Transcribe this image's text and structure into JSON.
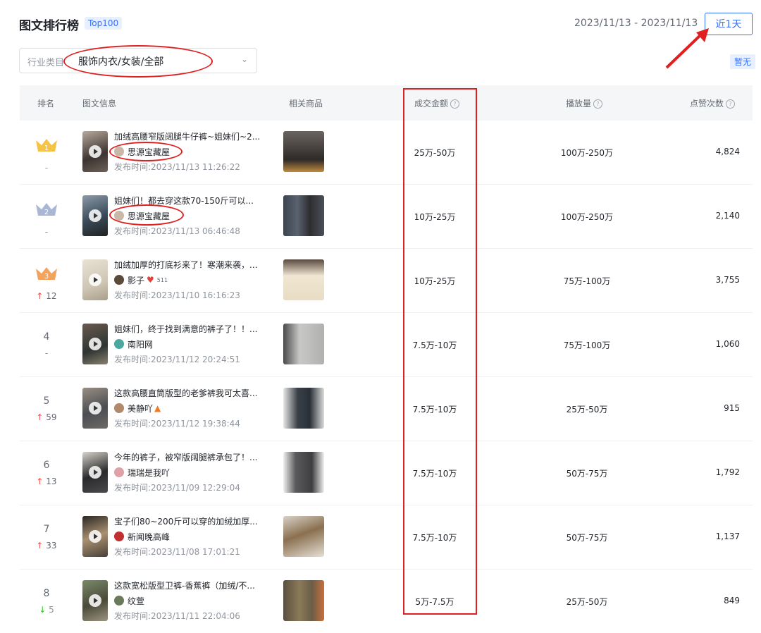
{
  "header": {
    "title": "图文排行榜",
    "badge": "Top100",
    "date_range": "2023/11/13 - 2023/11/13",
    "period_button": "近1天",
    "no_data_tag": "暂无"
  },
  "filter": {
    "label": "行业类目",
    "value": "服饰内衣/女装/全部"
  },
  "columns": {
    "rank": "排名",
    "info": "图文信息",
    "products": "相关商品",
    "gmv": "成交金额",
    "plays": "播放量",
    "likes": "点赞次数"
  },
  "rows": [
    {
      "rank": "1",
      "change": "-",
      "title": "加绒高腰窄版阔腿牛仔裤~姐妹们~2...",
      "author": "思源宝藏屋",
      "time": "发布时间:2023/11/13 11:26:22",
      "gmv": "25万-50万",
      "plays": "100万-250万",
      "likes": "4,824"
    },
    {
      "rank": "2",
      "change": "-",
      "title": "姐妹们！都去穿这款70-150斤可以...",
      "author": "思源宝藏屋",
      "time": "发布时间:2023/11/13 06:46:48",
      "gmv": "10万-25万",
      "plays": "100万-250万",
      "likes": "2,140"
    },
    {
      "rank": "3",
      "change": "12",
      "title": "加绒加厚的打底衫来了！寒潮来袭，...",
      "author": "影子",
      "author_extra": "511",
      "time": "发布时间:2023/11/10 16:16:23",
      "gmv": "10万-25万",
      "plays": "75万-100万",
      "likes": "3,755"
    },
    {
      "rank": "4",
      "change": "-",
      "title": "姐妹们，终于找到满意的裤子了！！...",
      "author": "南阳网",
      "time": "发布时间:2023/11/12 20:24:51",
      "gmv": "7.5万-10万",
      "plays": "75万-100万",
      "likes": "1,060"
    },
    {
      "rank": "5",
      "change": "59",
      "title": "这款高腰直筒版型的老爹裤我可太喜...",
      "author": "美静吖",
      "time": "发布时间:2023/11/12 19:38:44",
      "gmv": "7.5万-10万",
      "plays": "25万-50万",
      "likes": "915"
    },
    {
      "rank": "6",
      "change": "13",
      "title": "今年的裤子，被窄版阔腿裤承包了！...",
      "author": "瑞瑞是我吖",
      "time": "发布时间:2023/11/09 12:29:04",
      "gmv": "7.5万-10万",
      "plays": "50万-75万",
      "likes": "1,792"
    },
    {
      "rank": "7",
      "change": "33",
      "title": "宝子们80~200斤可以穿的加绒加厚...",
      "author": "新闻晚高峰",
      "time": "发布时间:2023/11/08 17:01:21",
      "gmv": "7.5万-10万",
      "plays": "50万-75万",
      "likes": "1,137"
    },
    {
      "rank": "8",
      "change": "5",
      "title": "这款宽松版型卫裤-香蕉裤（加绒/不...",
      "author": "纹萱",
      "time": "发布时间:2023/11/11 22:04:06",
      "gmv": "5万-7.5万",
      "plays": "25万-50万",
      "likes": "849"
    }
  ],
  "colors": {
    "accent": "#3370ff",
    "annotation_red": "#e02020",
    "rank_up": "#f54a45",
    "rank_down": "#34c724",
    "gold": "#f6c342",
    "silver": "#a9b6d6",
    "bronze": "#f3a35b"
  }
}
